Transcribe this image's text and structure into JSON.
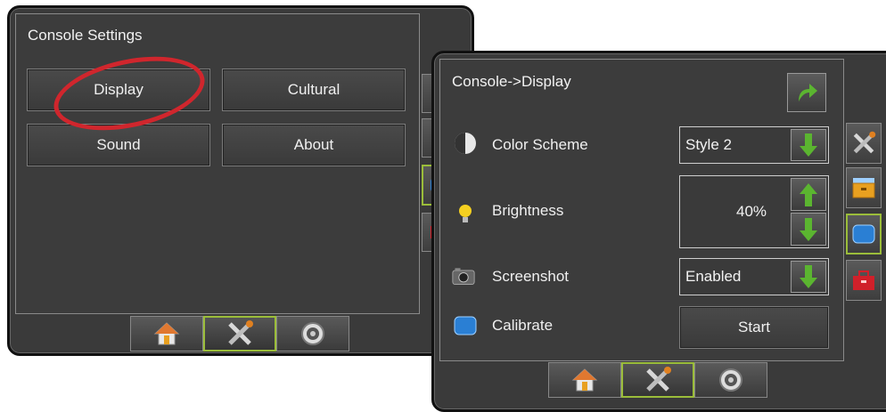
{
  "console_settings": {
    "title": "Console Settings",
    "buttons": {
      "display": "Display",
      "cultural": "Cultural",
      "sound": "Sound",
      "about": "About"
    },
    "nav": [
      "home-icon",
      "tools-icon",
      "gauge-icon"
    ]
  },
  "display_screen": {
    "title": "Console->Display",
    "rows": {
      "color_scheme": {
        "label": "Color Scheme",
        "value": "Style 2"
      },
      "brightness": {
        "label": "Brightness",
        "value": "40%"
      },
      "screenshot": {
        "label": "Screenshot",
        "value": "Enabled"
      },
      "calibrate": {
        "label": "Calibrate",
        "button": "Start"
      }
    },
    "side_tabs": [
      "tools-icon",
      "folder-icon",
      "monitor-icon",
      "toolbox-icon"
    ],
    "nav": [
      "home-icon",
      "tools-icon",
      "gauge-icon"
    ]
  },
  "colors": {
    "active_border": "#9bbd3a",
    "arrow_green": "#5bb530",
    "highlight_circle": "#d0262d"
  }
}
